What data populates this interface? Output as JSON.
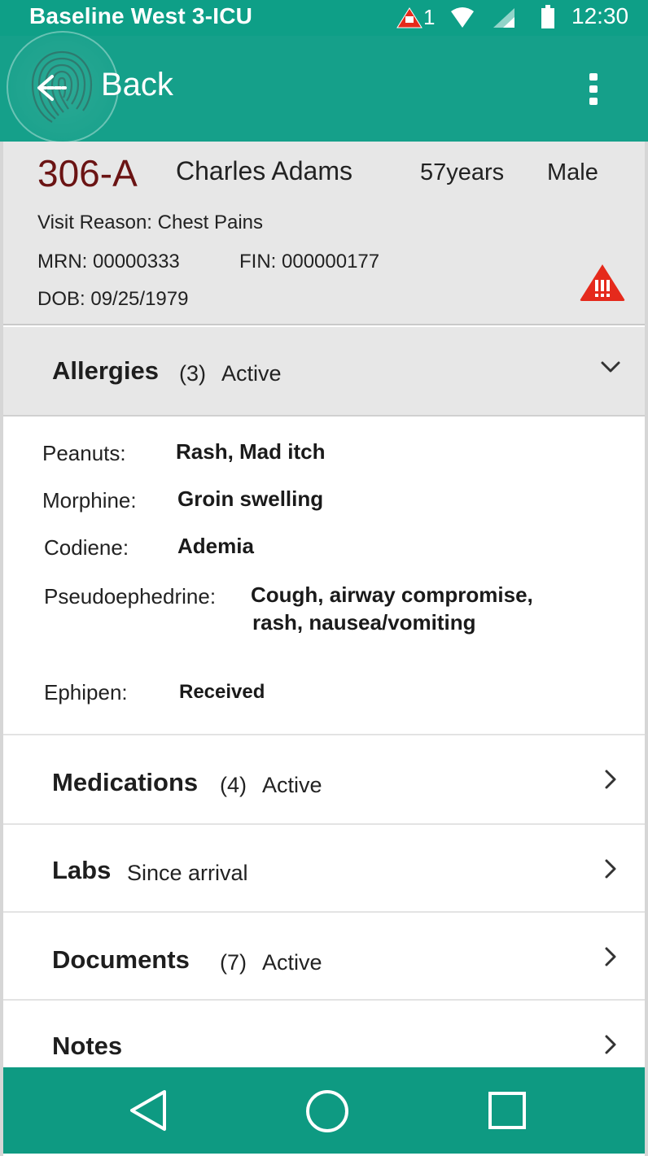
{
  "status_bar": {
    "unit_label": "Baseline West  3-ICU",
    "alert_count": "1",
    "time": "12:30",
    "icons": [
      "alert-icon",
      "wifi-icon",
      "cell-signal-icon",
      "battery-icon"
    ]
  },
  "app_bar": {
    "back_label": "Back",
    "icons": [
      "back-arrow-icon",
      "fingerprint-icon",
      "more-vert-icon"
    ]
  },
  "patient": {
    "room": "306-A",
    "name": "Charles Adams",
    "age": "57years",
    "sex": "Male",
    "visit_reason": "Visit Reason:  Chest Pains",
    "mrn": "MRN: 00000333",
    "fin": "FIN: 000000177",
    "dob": "DOB: 09/25/1979",
    "warning_icon": "alert-triangle-icon"
  },
  "allergies": {
    "title": "Allergies",
    "count": "(3)",
    "status": "Active",
    "items": [
      {
        "name": "Peanuts:",
        "reaction": "Rash, Mad itch"
      },
      {
        "name": "Morphine:",
        "reaction": "Groin swelling"
      },
      {
        "name": "Codiene:",
        "reaction": "Ademia"
      },
      {
        "name": "Pseudoephedrine:",
        "reaction_line1": "Cough, airway compromise,",
        "reaction_line2": "rash, nausea/vomiting"
      }
    ],
    "ephipen_label": "Ephipen:",
    "ephipen_value": "Received"
  },
  "sections": [
    {
      "title": "Medications",
      "count": "(4)",
      "status": "Active"
    },
    {
      "title": "Labs",
      "status": "Since arrival"
    },
    {
      "title": "Documents",
      "count": "(7)",
      "status": "Active"
    },
    {
      "title": "Notes"
    }
  ],
  "nav_bar": {
    "icons": [
      "nav-back-icon",
      "nav-home-icon",
      "nav-recents-icon"
    ]
  },
  "colors": {
    "status_bar": "#0e9f87",
    "app_bar": "#15a08a",
    "room_text": "#6b1414",
    "alert_red": "#e52a1c",
    "card_bg": "#e7e7e7",
    "nav_bar": "#0e9a82"
  }
}
